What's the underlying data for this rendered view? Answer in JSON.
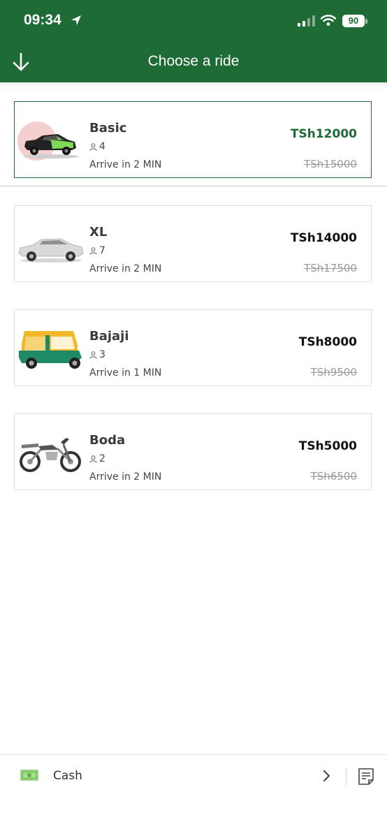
{
  "status": {
    "time": "09:34",
    "battery": "90"
  },
  "nav": {
    "title": "Choose a ride"
  },
  "rides": [
    {
      "name": "Basic",
      "seats": "4",
      "arrive": "Arrive in 2 MIN",
      "price": "TSh12000",
      "old_price": "TSh15000",
      "selected": true
    },
    {
      "name": "XL",
      "seats": "7",
      "arrive": "Arrive in 2 MIN",
      "price": "TSh14000",
      "old_price": "TSh17500",
      "selected": false
    },
    {
      "name": "Bajaji",
      "seats": "3",
      "arrive": "Arrive in 1 MIN",
      "price": "TSh8000",
      "old_price": "TSh9500",
      "selected": false
    },
    {
      "name": "Boda",
      "seats": "2",
      "arrive": "Arrive in 2 MIN",
      "price": "TSh5000",
      "old_price": "TSh6500",
      "selected": false
    }
  ],
  "payment": {
    "method": "Cash"
  },
  "icons": [
    "location-arrow-icon",
    "signal-icon",
    "wifi-icon",
    "battery-icon",
    "arrow-down-icon",
    "person-icon",
    "cash-icon",
    "chevron-right-icon",
    "note-icon"
  ],
  "colors": {
    "brand": "#1f6b36",
    "price_selected": "#1f6b36",
    "strike": "#9a9a9a"
  }
}
